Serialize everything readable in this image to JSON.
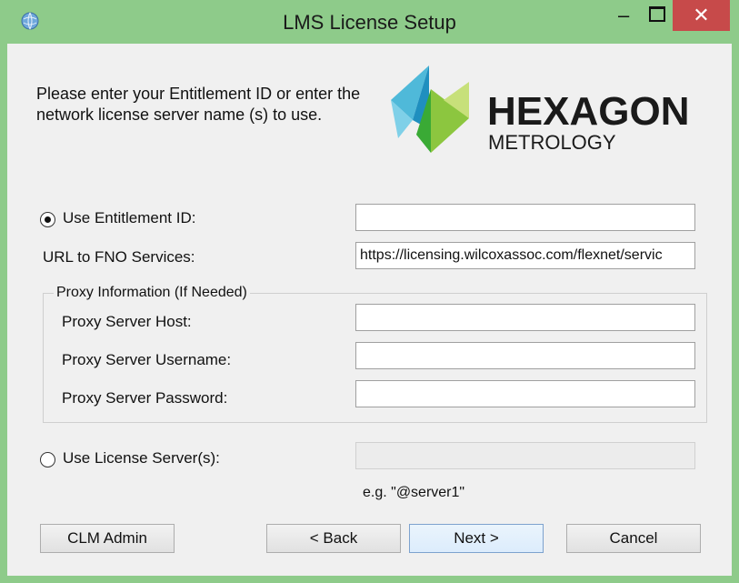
{
  "window": {
    "title": "LMS License Setup"
  },
  "titlebar": {
    "minimize": "–",
    "close": "✕"
  },
  "intro": {
    "text": "Please enter your Entitlement ID or enter the network license server name (s) to use."
  },
  "brand": {
    "name": "HEXAGON",
    "sub": "METROLOGY"
  },
  "entitlement": {
    "radio_label": "Use Entitlement ID:",
    "selected": true,
    "value": ""
  },
  "fno": {
    "label": "URL to FNO Services:",
    "value": "https://licensing.wilcoxassoc.com/flexnet/servic"
  },
  "proxy": {
    "legend": "Proxy Information (If Needed)",
    "host_label": "Proxy Server Host:",
    "username_label": "Proxy Server Username:",
    "password_label": "Proxy Server Password:"
  },
  "license_server": {
    "radio_label": "Use License Server(s):",
    "selected": false,
    "hint": "e.g. \"@server1\""
  },
  "buttons": {
    "clm_admin": "CLM Admin",
    "back": "< Back",
    "next": "Next >",
    "cancel": "Cancel"
  },
  "colors": {
    "titlebar": "#8ecb8a",
    "close": "#c74a4a",
    "dialog": "#f0f0f0"
  }
}
